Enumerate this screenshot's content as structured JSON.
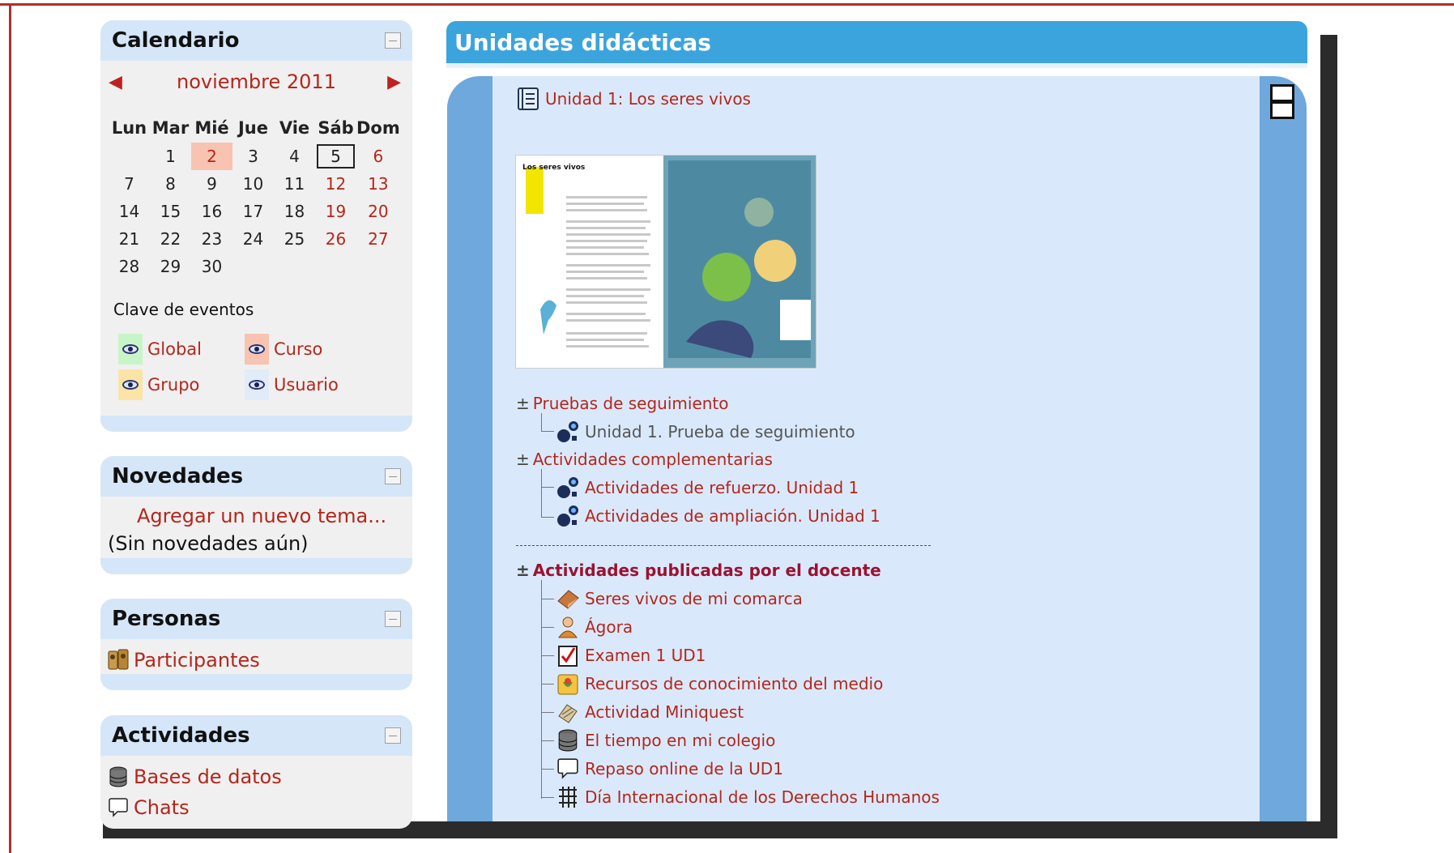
{
  "calendar": {
    "title": "Calendario",
    "month": "noviembre 2011",
    "weekdays": [
      "Lun",
      "Mar",
      "Mié",
      "Jue",
      "Vie",
      "Sáb",
      "Dom"
    ],
    "weeks": [
      [
        "",
        "1",
        "2",
        "3",
        "4",
        "5",
        "6"
      ],
      [
        "7",
        "8",
        "9",
        "10",
        "11",
        "12",
        "13"
      ],
      [
        "14",
        "15",
        "16",
        "17",
        "18",
        "19",
        "20"
      ],
      [
        "21",
        "22",
        "23",
        "24",
        "25",
        "26",
        "27"
      ],
      [
        "28",
        "29",
        "30",
        "",
        "",
        "",
        ""
      ]
    ],
    "events_title": "Clave de eventos",
    "events": [
      {
        "label": "Global",
        "color": "#c8f5c8"
      },
      {
        "label": "Curso",
        "color": "#f8c3b1"
      },
      {
        "label": "Grupo",
        "color": "#fbe4a6"
      },
      {
        "label": "Usuario",
        "color": "#e2ecf9"
      }
    ]
  },
  "novedades": {
    "title": "Novedades",
    "add_link": "Agregar un nuevo tema...",
    "empty": "(Sin novedades aún)"
  },
  "personas": {
    "title": "Personas",
    "participants": "Participantes"
  },
  "actividades": {
    "title": "Actividades",
    "items": [
      "Bases de datos",
      "Chats"
    ]
  },
  "main": {
    "section_title": "Unidades didácticas",
    "unit_title": "Unidad 1: Los seres vivos",
    "book_heading": "Los seres vivos",
    "groups": [
      {
        "label": "Pruebas de seguimiento",
        "items": [
          "Unidad 1. Prueba de seguimiento"
        ]
      },
      {
        "label": "Actividades complementarias",
        "items": [
          "Actividades de refuerzo. Unidad 1",
          "Actividades de ampliación. Unidad 1"
        ]
      },
      {
        "label": "Actividades publicadas por el docente",
        "items": [
          "Seres vivos de mi comarca",
          "Ágora",
          "Examen 1 UD1",
          "Recursos de conocimiento del medio",
          "Actividad Miniquest",
          "El tiempo en mi colegio",
          "Repaso online de la UD1",
          "Día Internacional de los Derechos Humanos"
        ]
      }
    ]
  },
  "colors": {
    "link": "#b5261c",
    "heading_bg": "#3ca4dc",
    "block_header": "#d5e6f9",
    "topic_bg": "#d9e9fb"
  }
}
